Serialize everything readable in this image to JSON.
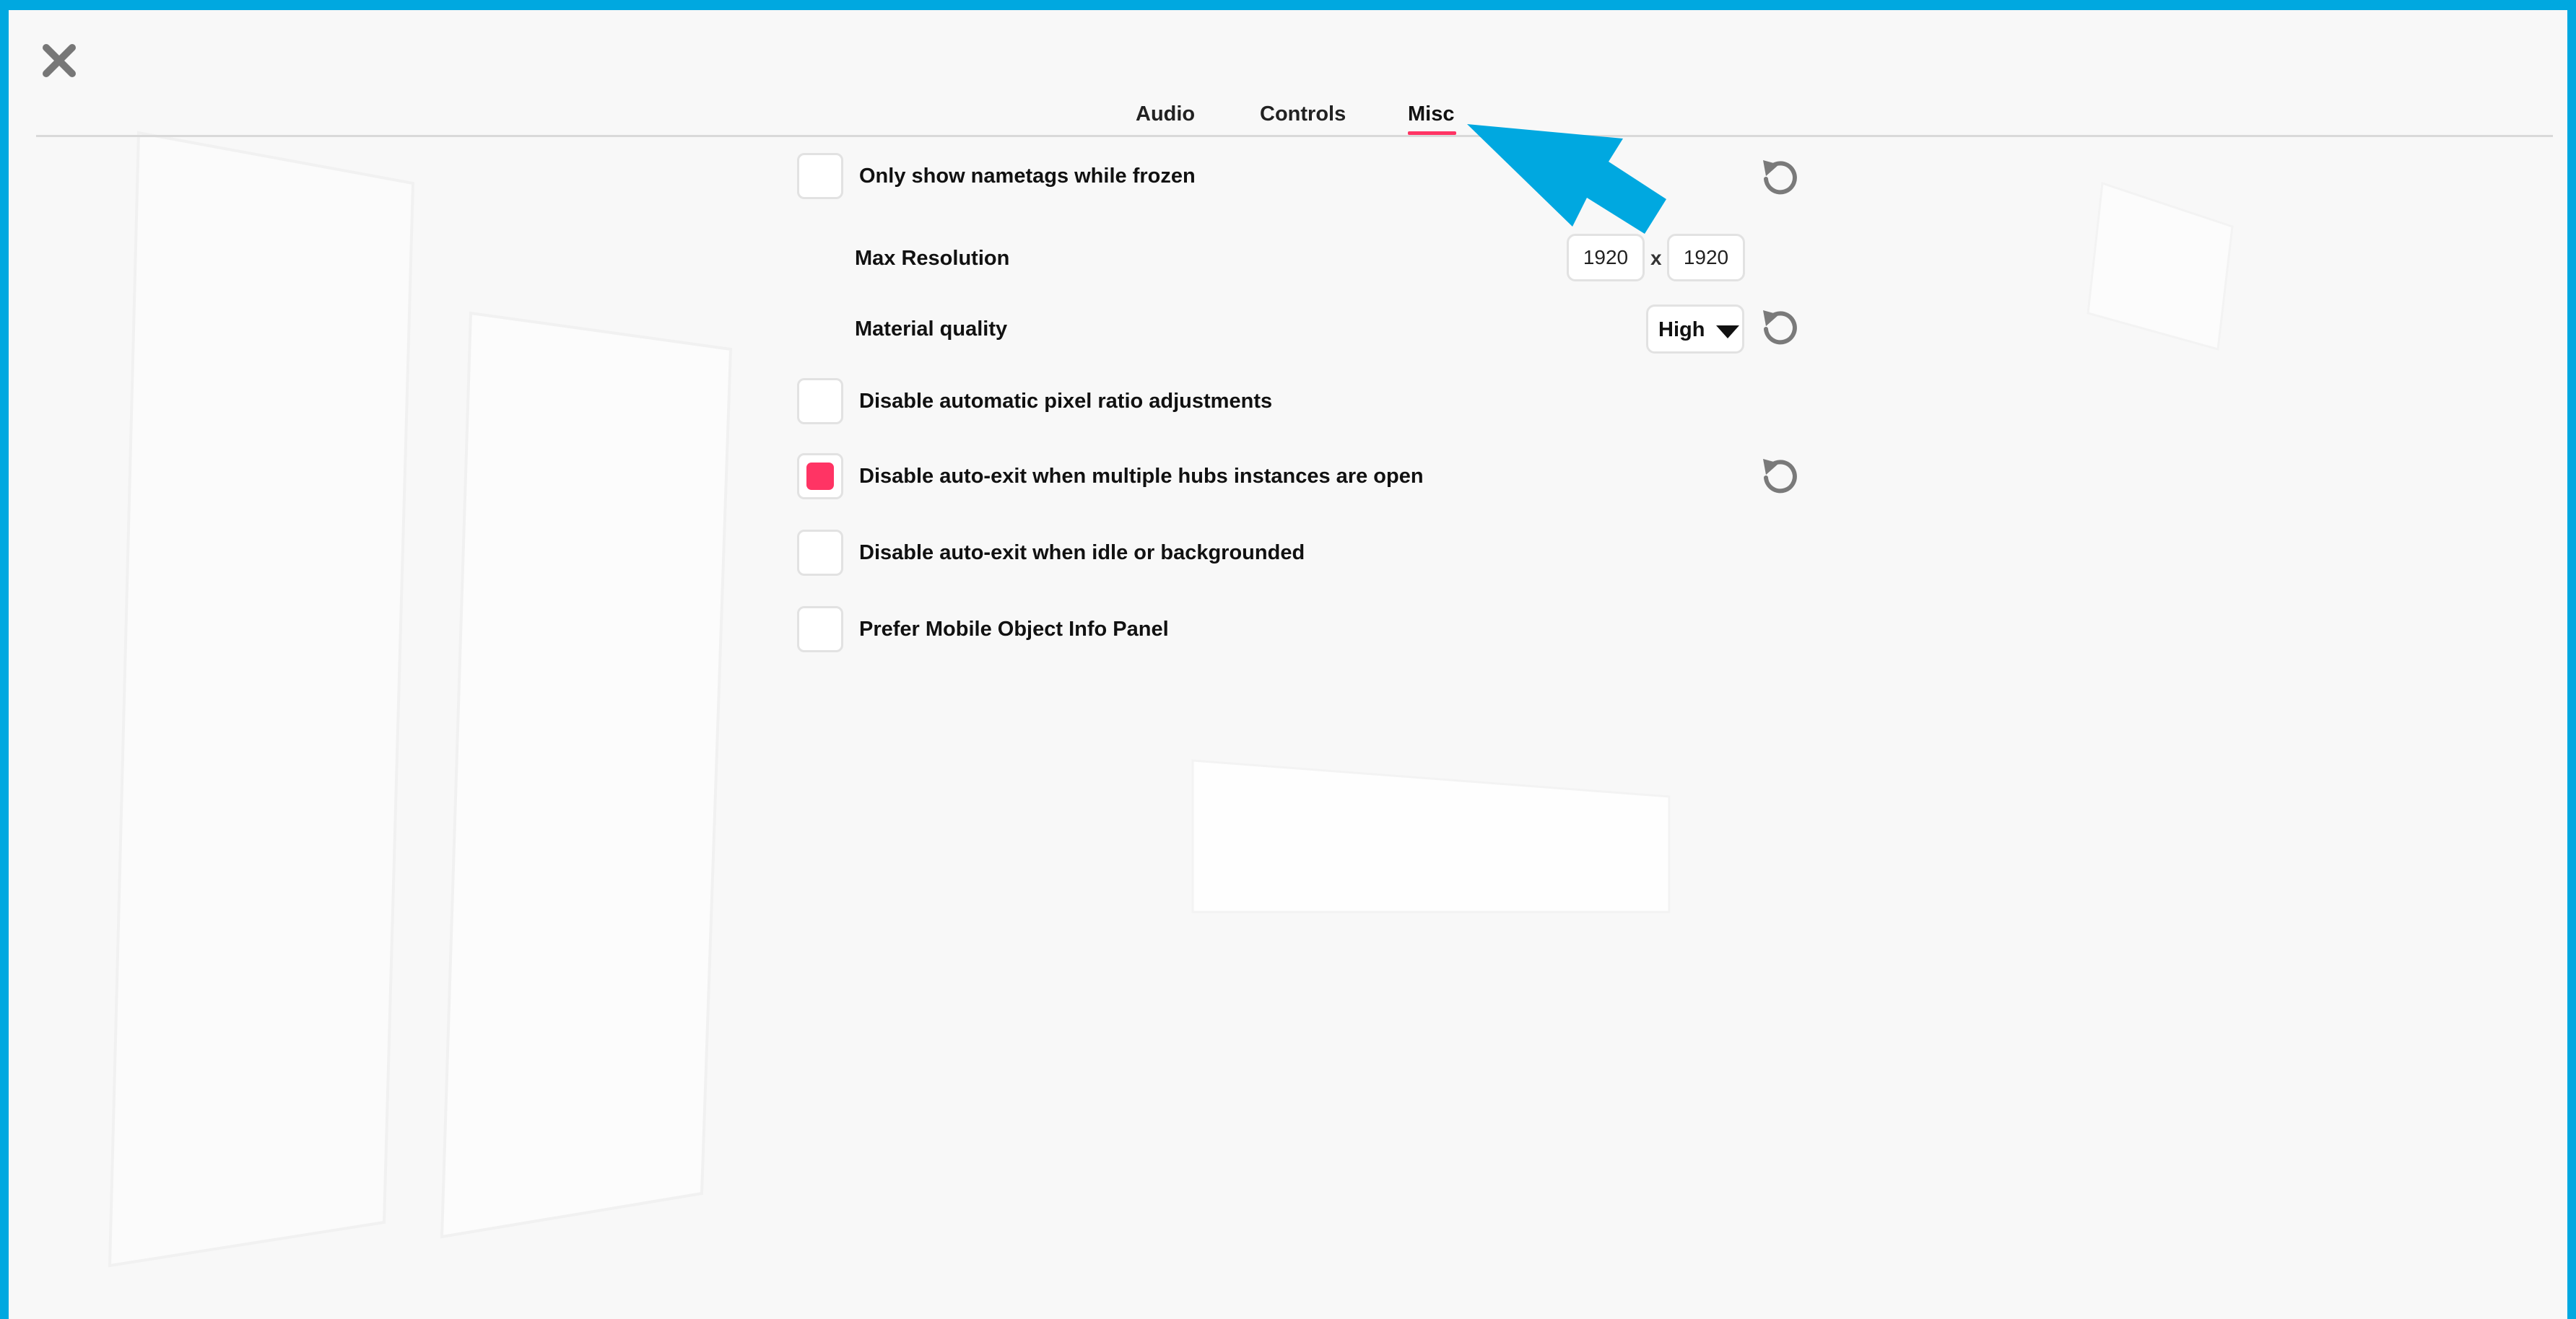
{
  "tabs": [
    {
      "label": "Audio"
    },
    {
      "label": "Controls"
    },
    {
      "label": "Misc",
      "active": true
    }
  ],
  "settings": {
    "nametags": {
      "label": "Only show nametags while frozen",
      "checked": false
    },
    "max_resolution": {
      "label": "Max Resolution",
      "width": "1920",
      "separator": "x",
      "height": "1920"
    },
    "material_quality": {
      "label": "Material quality",
      "value": "High"
    },
    "pixel_ratio": {
      "label": "Disable automatic pixel ratio adjustments",
      "checked": false
    },
    "multi_instance_exit": {
      "label": "Disable auto-exit when multiple hubs instances are open",
      "checked": true
    },
    "idle_exit": {
      "label": "Disable auto-exit when idle or backgrounded",
      "checked": false
    },
    "mobile_panel": {
      "label": "Prefer Mobile Object Info Panel",
      "checked": false
    }
  },
  "colors": {
    "accent": "#ff3464",
    "frame": "#00a8e0",
    "annotation_arrow": "#00a8e0"
  },
  "icons": {
    "close": "close-icon",
    "reset": "reset-icon",
    "dropdown": "caret-down-icon",
    "annotation": "arrow-annotation-icon"
  }
}
